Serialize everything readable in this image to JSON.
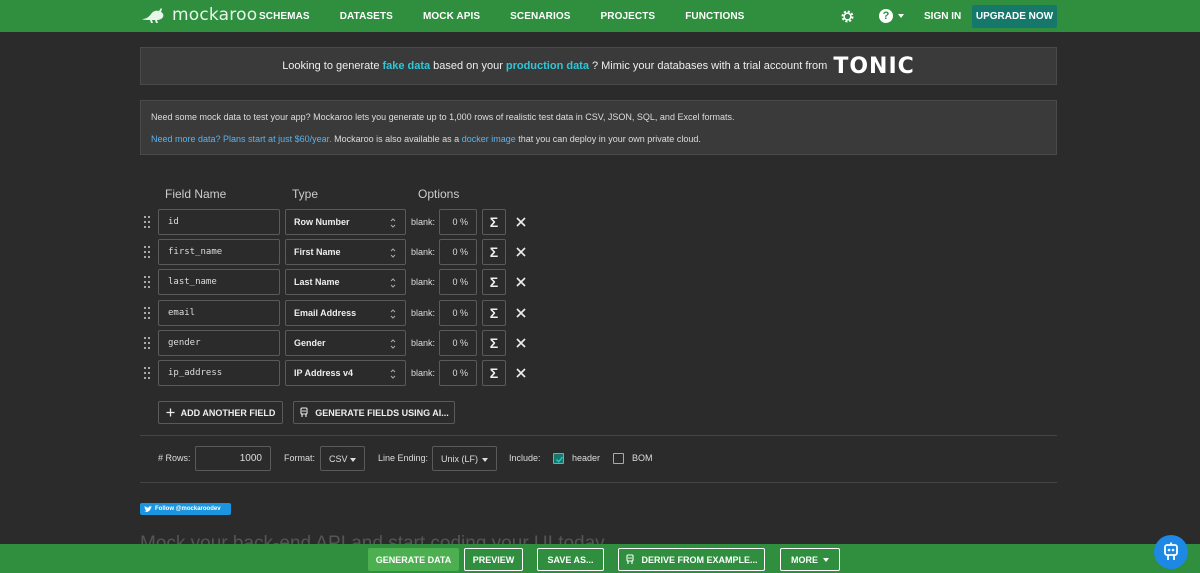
{
  "nav": {
    "brand": "mockaroo",
    "links": [
      "SCHEMAS",
      "DATASETS",
      "MOCK APIS",
      "SCENARIOS",
      "PROJECTS",
      "FUNCTIONS"
    ],
    "help_icon": "?",
    "sign_in": "SIGN IN",
    "upgrade": "UPGRADE NOW"
  },
  "tonic_banner": {
    "pre": "Looking to generate",
    "fake_data": "fake data",
    "mid": "based on your",
    "production_data": "production data",
    "post": "? Mimic your databases with a trial account from",
    "logo": "TONIC"
  },
  "info": {
    "line1": "Need some mock data to test your app? Mockaroo lets you generate up to 1,000 rows of realistic test data in CSV, JSON, SQL, and Excel formats.",
    "more_data_link": "Need more data? Plans start at just $60/year.",
    "line2_mid": " Mockaroo is also available as a ",
    "docker_link": "docker image",
    "line2_end": " that you can deploy in your own private cloud."
  },
  "table": {
    "headers": {
      "field_name": "Field Name",
      "type": "Type",
      "options": "Options"
    },
    "blank_label": "blank:",
    "sigma": "Σ",
    "fields": [
      {
        "name": "id",
        "type": "Row Number",
        "blank": "0 %"
      },
      {
        "name": "first_name",
        "type": "First Name",
        "blank": "0 %"
      },
      {
        "name": "last_name",
        "type": "Last Name",
        "blank": "0 %"
      },
      {
        "name": "email",
        "type": "Email Address",
        "blank": "0 %"
      },
      {
        "name": "gender",
        "type": "Gender",
        "blank": "0 %"
      },
      {
        "name": "ip_address",
        "type": "IP Address v4",
        "blank": "0 %"
      }
    ],
    "add_field": "ADD ANOTHER FIELD",
    "ai_fields": "GENERATE FIELDS USING AI..."
  },
  "options": {
    "rows_label": "# Rows:",
    "rows_value": "1000",
    "format_label": "Format:",
    "format_value": "CSV",
    "line_ending_label": "Line Ending:",
    "line_ending_value": "Unix (LF)",
    "include_label": "Include:",
    "header_label": "header",
    "header_checked": true,
    "bom_label": "BOM",
    "bom_checked": false
  },
  "twitter": "Follow @mockaroodev",
  "headline": "Mock your back-end API and start coding your UI today.",
  "bottom": {
    "generate": "GENERATE DATA",
    "preview": "PREVIEW",
    "save_as": "SAVE AS...",
    "derive": "DERIVE FROM EXAMPLE...",
    "more": "MORE"
  },
  "colors": {
    "brand_green": "#2f8f3e",
    "teal": "#16786b",
    "highlight": "#2ec7d6",
    "link": "#59b3f0"
  }
}
